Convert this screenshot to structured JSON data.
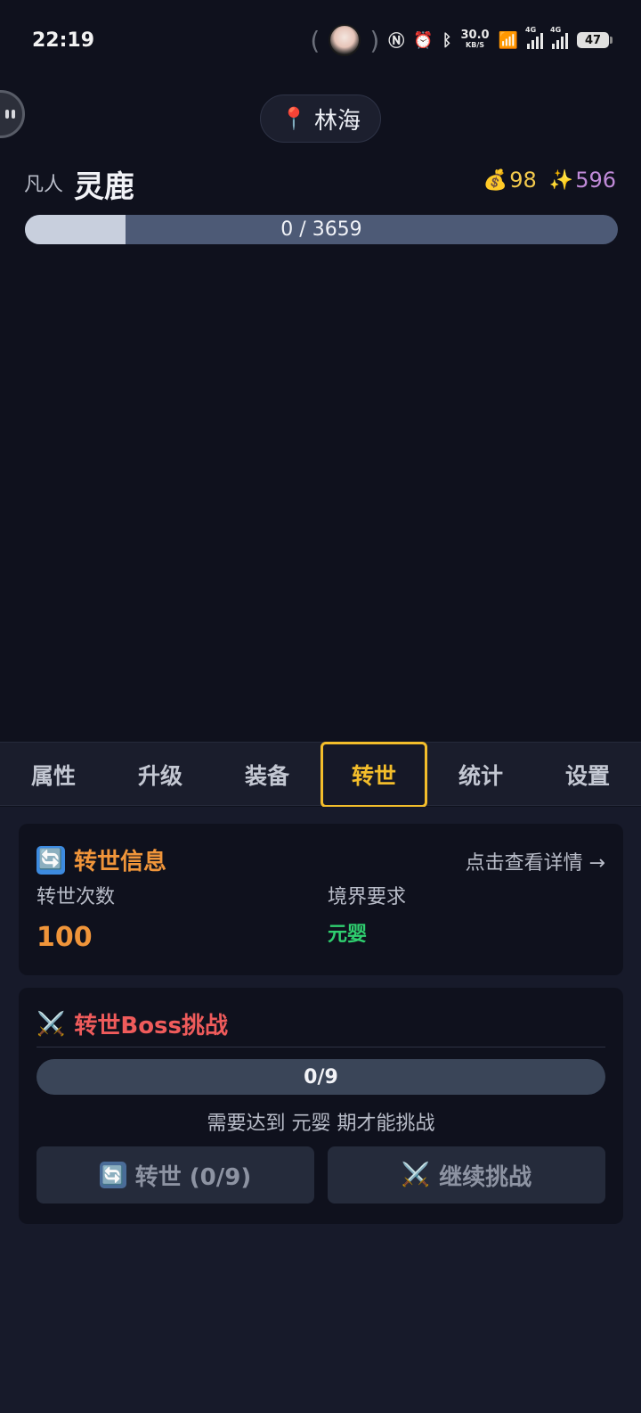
{
  "status_bar": {
    "time": "22:19",
    "net_speed_value": "30.0",
    "net_speed_unit": "KB/S",
    "signal_label_1": "4G",
    "signal_label_2": "4G",
    "battery": "47",
    "icons": [
      "nfc-icon",
      "alarm-icon",
      "bluetooth-icon",
      "wifi-icon",
      "signal-icon",
      "battery-icon"
    ]
  },
  "location": {
    "pin_icon": "📍",
    "name": "林海"
  },
  "player": {
    "rank": "凡人",
    "name": "灵鹿"
  },
  "currency": {
    "gold_icon": "💰",
    "gold": "98",
    "spirit_icon": "✨",
    "spirit": "596"
  },
  "exp": {
    "text": "0 / 3659",
    "fill_fraction": 0.17
  },
  "tabs": [
    {
      "label": "属性",
      "active": false
    },
    {
      "label": "升级",
      "active": false
    },
    {
      "label": "装备",
      "active": false
    },
    {
      "label": "转世",
      "active": true
    },
    {
      "label": "统计",
      "active": false
    },
    {
      "label": "设置",
      "active": false
    }
  ],
  "rebirth_info": {
    "icon": "🔄",
    "title": "转世信息",
    "detail_link": "点击查看详情 →",
    "count_label": "转世次数",
    "count_value": "100",
    "realm_label": "境界要求",
    "realm_value": "元婴"
  },
  "boss_challenge": {
    "icon": "⚔️",
    "title": "转世Boss挑战",
    "progress_text": "0/9",
    "requirement": "需要达到 元婴 期才能挑战",
    "rebirth_button_icon": "🔄",
    "rebirth_button": "转世 (0/9)",
    "continue_button_icon": "⚔️",
    "continue_button": "继续挑战"
  },
  "colors": {
    "background": "#0f111d",
    "accent_gold": "#f3bd2b",
    "orange": "#f0953a",
    "green": "#2fcf6f",
    "red": "#ef5b5b"
  }
}
